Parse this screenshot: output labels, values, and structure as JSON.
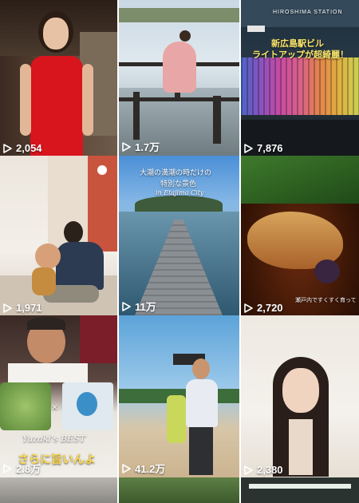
{
  "tiles": [
    {
      "views": "2,054"
    },
    {
      "views": "1.7万"
    },
    {
      "views": "7,876",
      "sign_top": "HIROSHIMA STATION",
      "caption_1": "新広島駅ビル",
      "caption_2": "ライトアップが超綺麗！"
    },
    {
      "views": "1,971"
    },
    {
      "views": "11万",
      "caption_1": "大潮の満潮の時だけの",
      "caption_2": "特別な景色",
      "caption_3": "in Etajima City"
    },
    {
      "views": "2,720",
      "caption_1": "瀬戸内ですくすく育って"
    },
    {
      "views": "2.8万",
      "caption_1": "Yuzaki's BEST",
      "caption_2": "さらに旨いんよ"
    },
    {
      "views": "41.2万"
    },
    {
      "views": "2,380"
    }
  ]
}
